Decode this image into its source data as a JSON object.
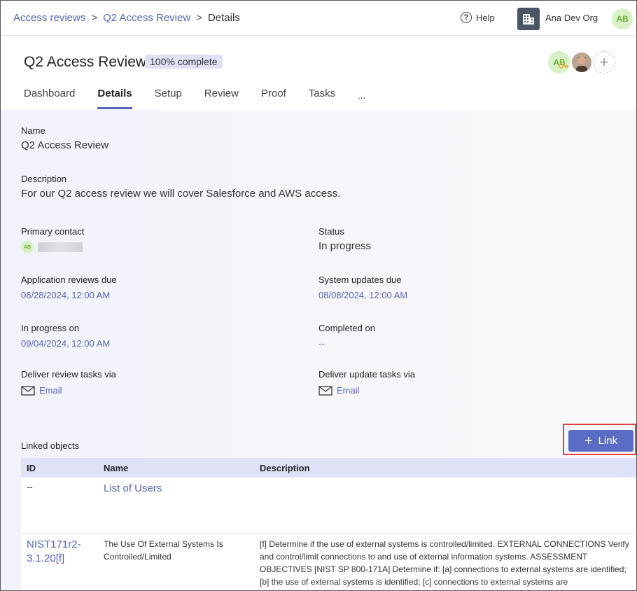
{
  "breadcrumb": {
    "items": [
      "Access reviews",
      "Q2 Access Review"
    ],
    "current": "Details",
    "separator": ">"
  },
  "topbar": {
    "help_label": "Help",
    "org_name": "Ana Dev Org",
    "user_initials": "AB"
  },
  "header": {
    "title": "Q2 Access Review",
    "progress_badge": "100% complete",
    "progress_value": 1.0,
    "assignees": {
      "initials": "AB"
    }
  },
  "tabs": [
    {
      "label": "Dashboard"
    },
    {
      "label": "Details"
    },
    {
      "label": "Setup"
    },
    {
      "label": "Review"
    },
    {
      "label": "Proof"
    },
    {
      "label": "Tasks"
    },
    {
      "label": "..."
    }
  ],
  "active_tab": "Details",
  "details": {
    "name_label": "Name",
    "name_value": "Q2 Access Review",
    "description_label": "Description",
    "description_value": "For our Q2 access review we will cover Salesforce and AWS access.",
    "primary_contact_label": "Primary contact",
    "primary_contact_initials": "AB",
    "status_label": "Status",
    "status_value": "In progress",
    "app_reviews_due_label": "Application reviews due",
    "app_reviews_due_value": "06/28/2024, 12:00 AM",
    "system_updates_due_label": "System updates due",
    "system_updates_due_value": "08/08/2024, 12:00 AM",
    "in_progress_on_label": "In progress on",
    "in_progress_on_value": "09/04/2024, 12:00 AM",
    "completed_on_label": "Completed on",
    "completed_on_value": "--",
    "deliver_review_label": "Deliver review tasks via",
    "deliver_review_value": "Email",
    "deliver_update_label": "Deliver update tasks via",
    "deliver_update_value": "Email"
  },
  "linked_objects": {
    "label": "Linked objects",
    "link_button": "Link",
    "columns": [
      "ID",
      "Name",
      "Description"
    ],
    "rows": [
      {
        "id": "--",
        "name": "List of Users",
        "description": ""
      },
      {
        "id": "NIST171r2-3.1.20[f]",
        "name": "The Use Of External Systems Is Controlled/Limited",
        "description": "[f] Determine if the use of external systems is controlled/limited. EXTERNAL CONNECTIONS Verify and control/limit connections to and use of external information systems. ASSESSMENT OBJECTIVES [NIST SP 800-171A] Determine if: [a] connections to external systems are identified; [b] the use of external systems is identified; [c] connections to external systems are"
      }
    ]
  },
  "colors": {
    "accent": "#5567b8",
    "button": "#5b6cc4",
    "badge_bg": "#dfe2f7",
    "avatar_bg": "#d8f2c8",
    "avatar_fg": "#6fae3b",
    "highlight": "#e0403a"
  },
  "icons": [
    "help-icon",
    "building-icon",
    "key-icon",
    "plus-icon",
    "mail-icon"
  ]
}
